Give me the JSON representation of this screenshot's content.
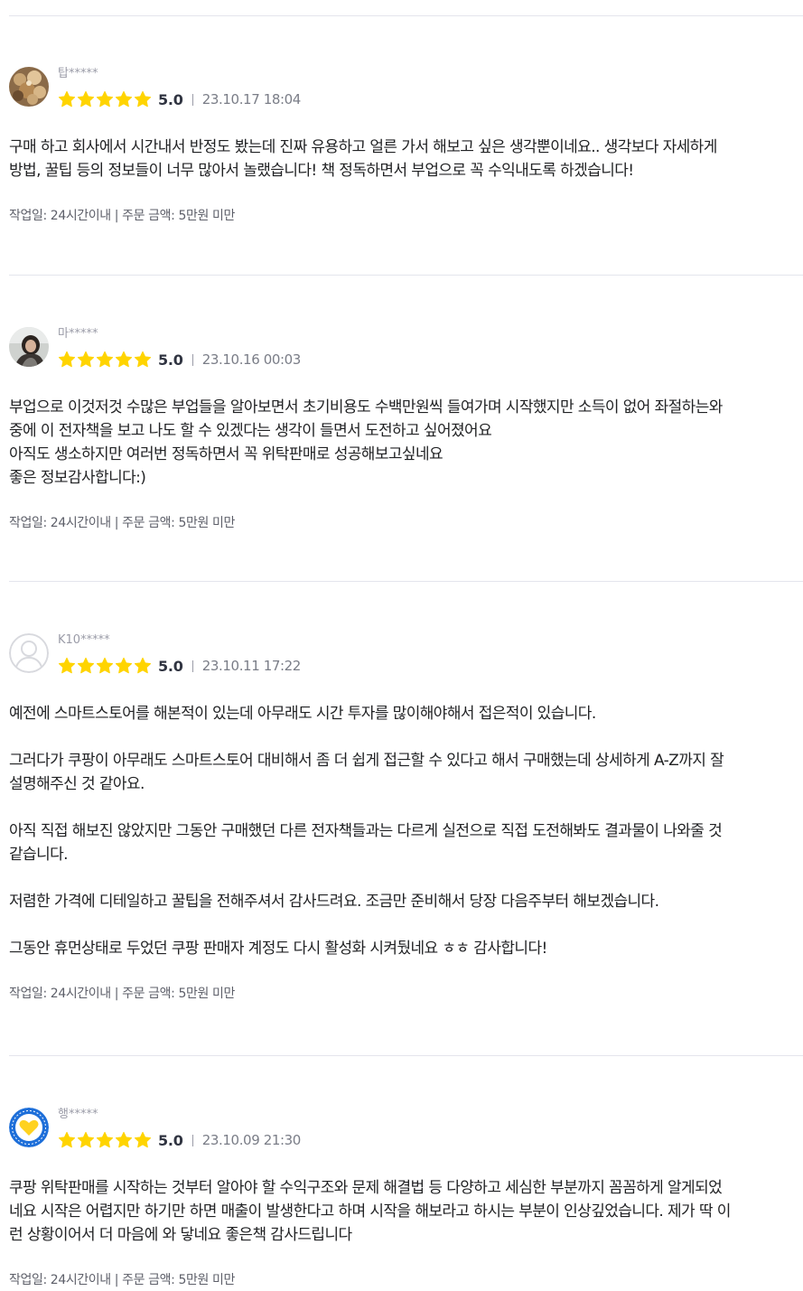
{
  "reviews": [
    {
      "username": "탑*****",
      "avatar": "food-photo-avatar",
      "rating_stars": 5,
      "score": "5.0",
      "date": "23.10.17 18:04",
      "body": [
        "구매 하고 회사에서 시간내서 반정도 봤는데 진짜 유용하고 얼른 가서 해보고 싶은 생각뿐이네요.. 생각보다 자세하게",
        "방법, 꿀팁 등의 정보들이 너무 많아서 놀랬습니다! 책 정독하면서 부업으로 꼭 수익내도록 하겠습니다!"
      ],
      "meta": "작업일: 24시간이내 | 주문 금액: 5만원 미만"
    },
    {
      "username": "마*****",
      "avatar": "person-photo-avatar",
      "rating_stars": 5,
      "score": "5.0",
      "date": "23.10.16 00:03",
      "body": [
        "부업으로 이것저것 수많은 부업들을 알아보면서 초기비용도 수백만원씩 들여가며 시작했지만 소득이 없어 좌절하는와",
        "중에 이 전자책을 보고 나도 할 수 있겠다는 생각이 들면서 도전하고 싶어졌어요",
        "아직도 생소하지만 여러번 정독하면서 꼭 위탁판매로 성공해보고싶네요",
        "좋은 정보감사합니다:)"
      ],
      "meta": "작업일: 24시간이내 | 주문 금액: 5만원 미만"
    },
    {
      "username": "K10*****",
      "avatar": "default-user-avatar",
      "rating_stars": 5,
      "score": "5.0",
      "date": "23.10.11 17:22",
      "body": [
        "예전에 스마트스토어를 해본적이 있는데 아무래도 시간 투자를 많이해야해서 접은적이 있습니다.",
        "",
        "그러다가 쿠팡이 아무래도 스마트스토어 대비해서 좀 더 쉽게 접근할 수 있다고 해서 구매했는데 상세하게 A-Z까지 잘",
        "설명해주신 것 같아요.",
        "",
        "아직 직접 해보진 않았지만 그동안 구매했던 다른 전자책들과는 다르게 실전으로 직접 도전해봐도 결과물이 나와줄 것",
        "같습니다.",
        "",
        "저렴한 가격에 디테일하고 꿀팁을 전해주셔서 감사드려요. 조금만 준비해서 당장 다음주부터 해보겠습니다.",
        "",
        "그동안 휴먼상태로 두었던 쿠팡 판매자 계정도 다시 활성화 시켜뒀네요 ㅎㅎ 감사합니다!"
      ],
      "meta": "작업일: 24시간이내 | 주문 금액: 5만원 미만"
    },
    {
      "username": "행*****",
      "avatar": "heart-badge-avatar",
      "rating_stars": 5,
      "score": "5.0",
      "date": "23.10.09 21:30",
      "body": [
        "쿠팡 위탁판매를 시작하는 것부터 알아야 할 수익구조와  문제 해결법 등 다양하고 세심한 부분까지 꼼꼼하게 알게되었",
        "네요  시작은 어렵지만 하기만 하면 매출이 발생한다고 하며 시작을 해보라고 하시는 부분이 인상깊었습니다. 제가 딱 이",
        "런 상황이어서 더 마음에 와 닿네요  좋은책 감사드립니다"
      ],
      "meta": "작업일: 24시간이내 | 주문 금액: 5만원 미만"
    }
  ],
  "colors": {
    "star": "#ffd400",
    "divider": "#e4e5ed",
    "muted": "#9a9ba7",
    "text": "#212224"
  }
}
